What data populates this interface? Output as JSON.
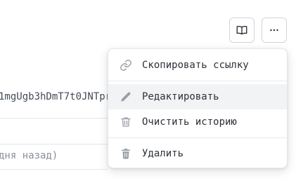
{
  "background": {
    "code_text": "1mgUgb3hDmT7t0JNTpr",
    "meta_text": "дня назад)"
  },
  "toolbar": {
    "docs_icon": "book-open-icon",
    "more_icon": "ellipsis-icon"
  },
  "menu": {
    "items": [
      {
        "label": "Скопировать ссылку",
        "icon": "link-icon"
      },
      {
        "label": "Редактировать",
        "icon": "pencil-icon",
        "highlighted": true
      },
      {
        "label": "Очистить историю",
        "icon": "trash-icon"
      },
      {
        "label": "Удалить",
        "icon": "trash-filled-icon"
      }
    ]
  },
  "colors": {
    "icon": "#9aa0a8",
    "text": "#2c3138",
    "hover": "#f1f3f5",
    "border": "#d0d4d9"
  }
}
